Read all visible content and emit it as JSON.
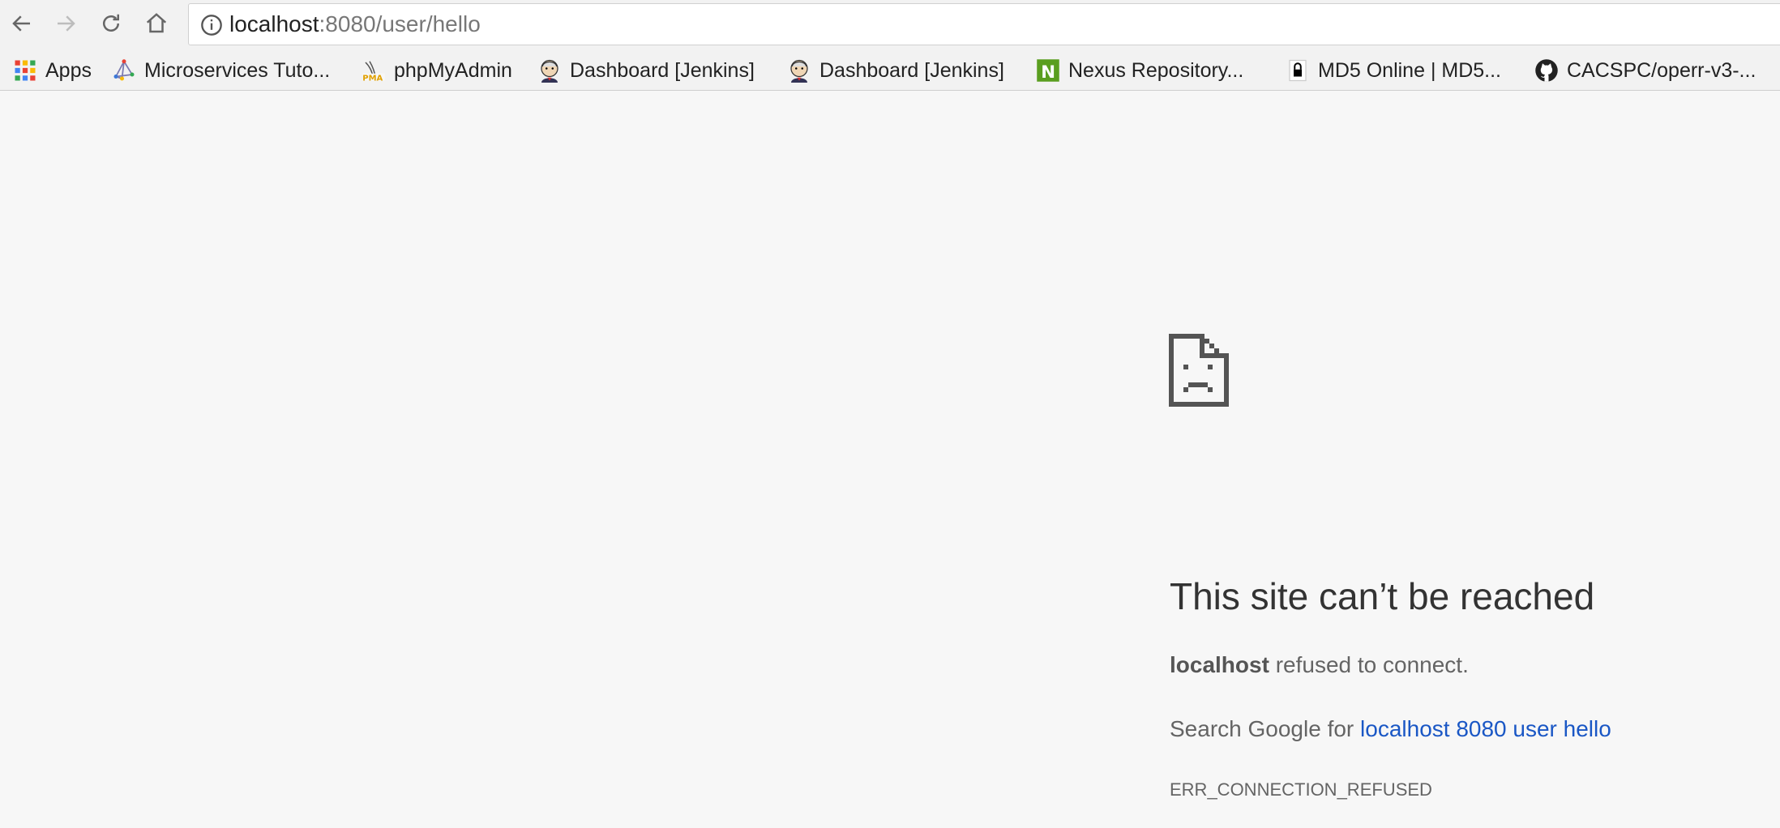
{
  "browser": {
    "omnibox": {
      "host": "localhost",
      "path": ":8080/user/hello"
    },
    "nav": {
      "back_icon": "back-arrow-icon",
      "forward_icon": "forward-arrow-icon",
      "reload_icon": "reload-icon",
      "home_icon": "home-icon",
      "info_icon": "info-icon"
    },
    "bookmarks": [
      {
        "label": "Apps",
        "icon": "apps-grid-icon"
      },
      {
        "label": "Microservices Tuto...",
        "icon": "network-icon"
      },
      {
        "label": "phpMyAdmin",
        "icon": "phpmyadmin-icon"
      },
      {
        "label": "Dashboard [Jenkins]",
        "icon": "jenkins-icon"
      },
      {
        "label": "Dashboard [Jenkins]",
        "icon": "jenkins-icon"
      },
      {
        "label": "Nexus Repository...",
        "icon": "nexus-icon"
      },
      {
        "label": "MD5 Online | MD5...",
        "icon": "lock-icon"
      },
      {
        "label": "CACSPC/operr-v3-...",
        "icon": "github-icon"
      }
    ]
  },
  "error": {
    "title": "This site can’t be reached",
    "detail_host": "localhost",
    "detail_text": " refused to connect.",
    "search_prefix": "Search Google for ",
    "search_link": "localhost 8080 user hello",
    "code": "ERR_CONNECTION_REFUSED"
  },
  "colors": {
    "link": "#1a57c5",
    "background": "#f7f7f7",
    "nexus_green": "#5a9e1f"
  }
}
